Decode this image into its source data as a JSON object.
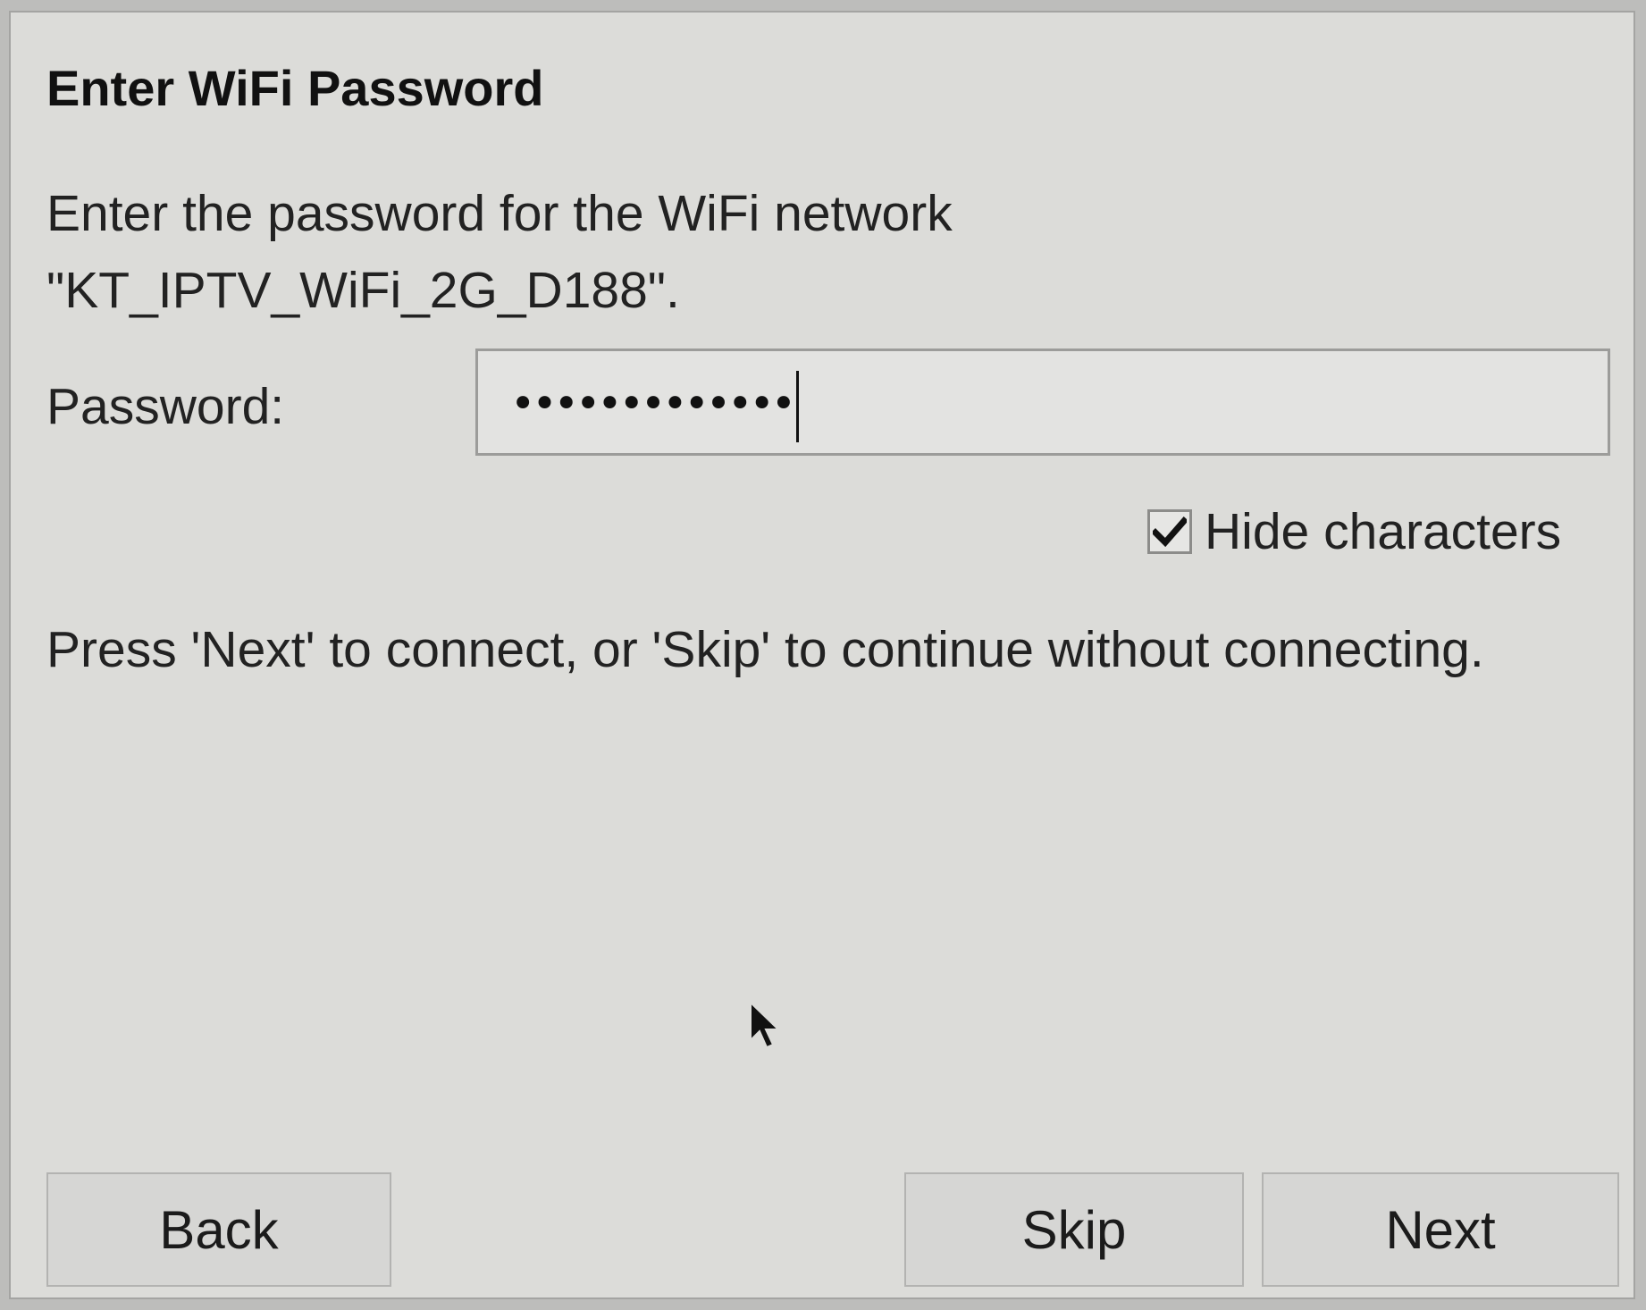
{
  "dialog": {
    "title": "Enter WiFi Password",
    "description": "Enter the password for the WiFi network \"KT_IPTV_WiFi_2G_D188\".",
    "password_label": "Password:",
    "password_masked": "•••••••••••••",
    "hide_characters": {
      "label": "Hide characters",
      "checked": true
    },
    "instructions": "Press 'Next' to connect, or 'Skip' to continue without connecting."
  },
  "buttons": {
    "back": "Back",
    "skip": "Skip",
    "next": "Next"
  },
  "colors": {
    "dialog_background": "#dcdcd9",
    "text": "#1c1c1c",
    "field_background": "#e3e3e1"
  },
  "icons": {
    "checkbox": "checkmark-icon",
    "pointer": "mouse-pointer-icon"
  }
}
